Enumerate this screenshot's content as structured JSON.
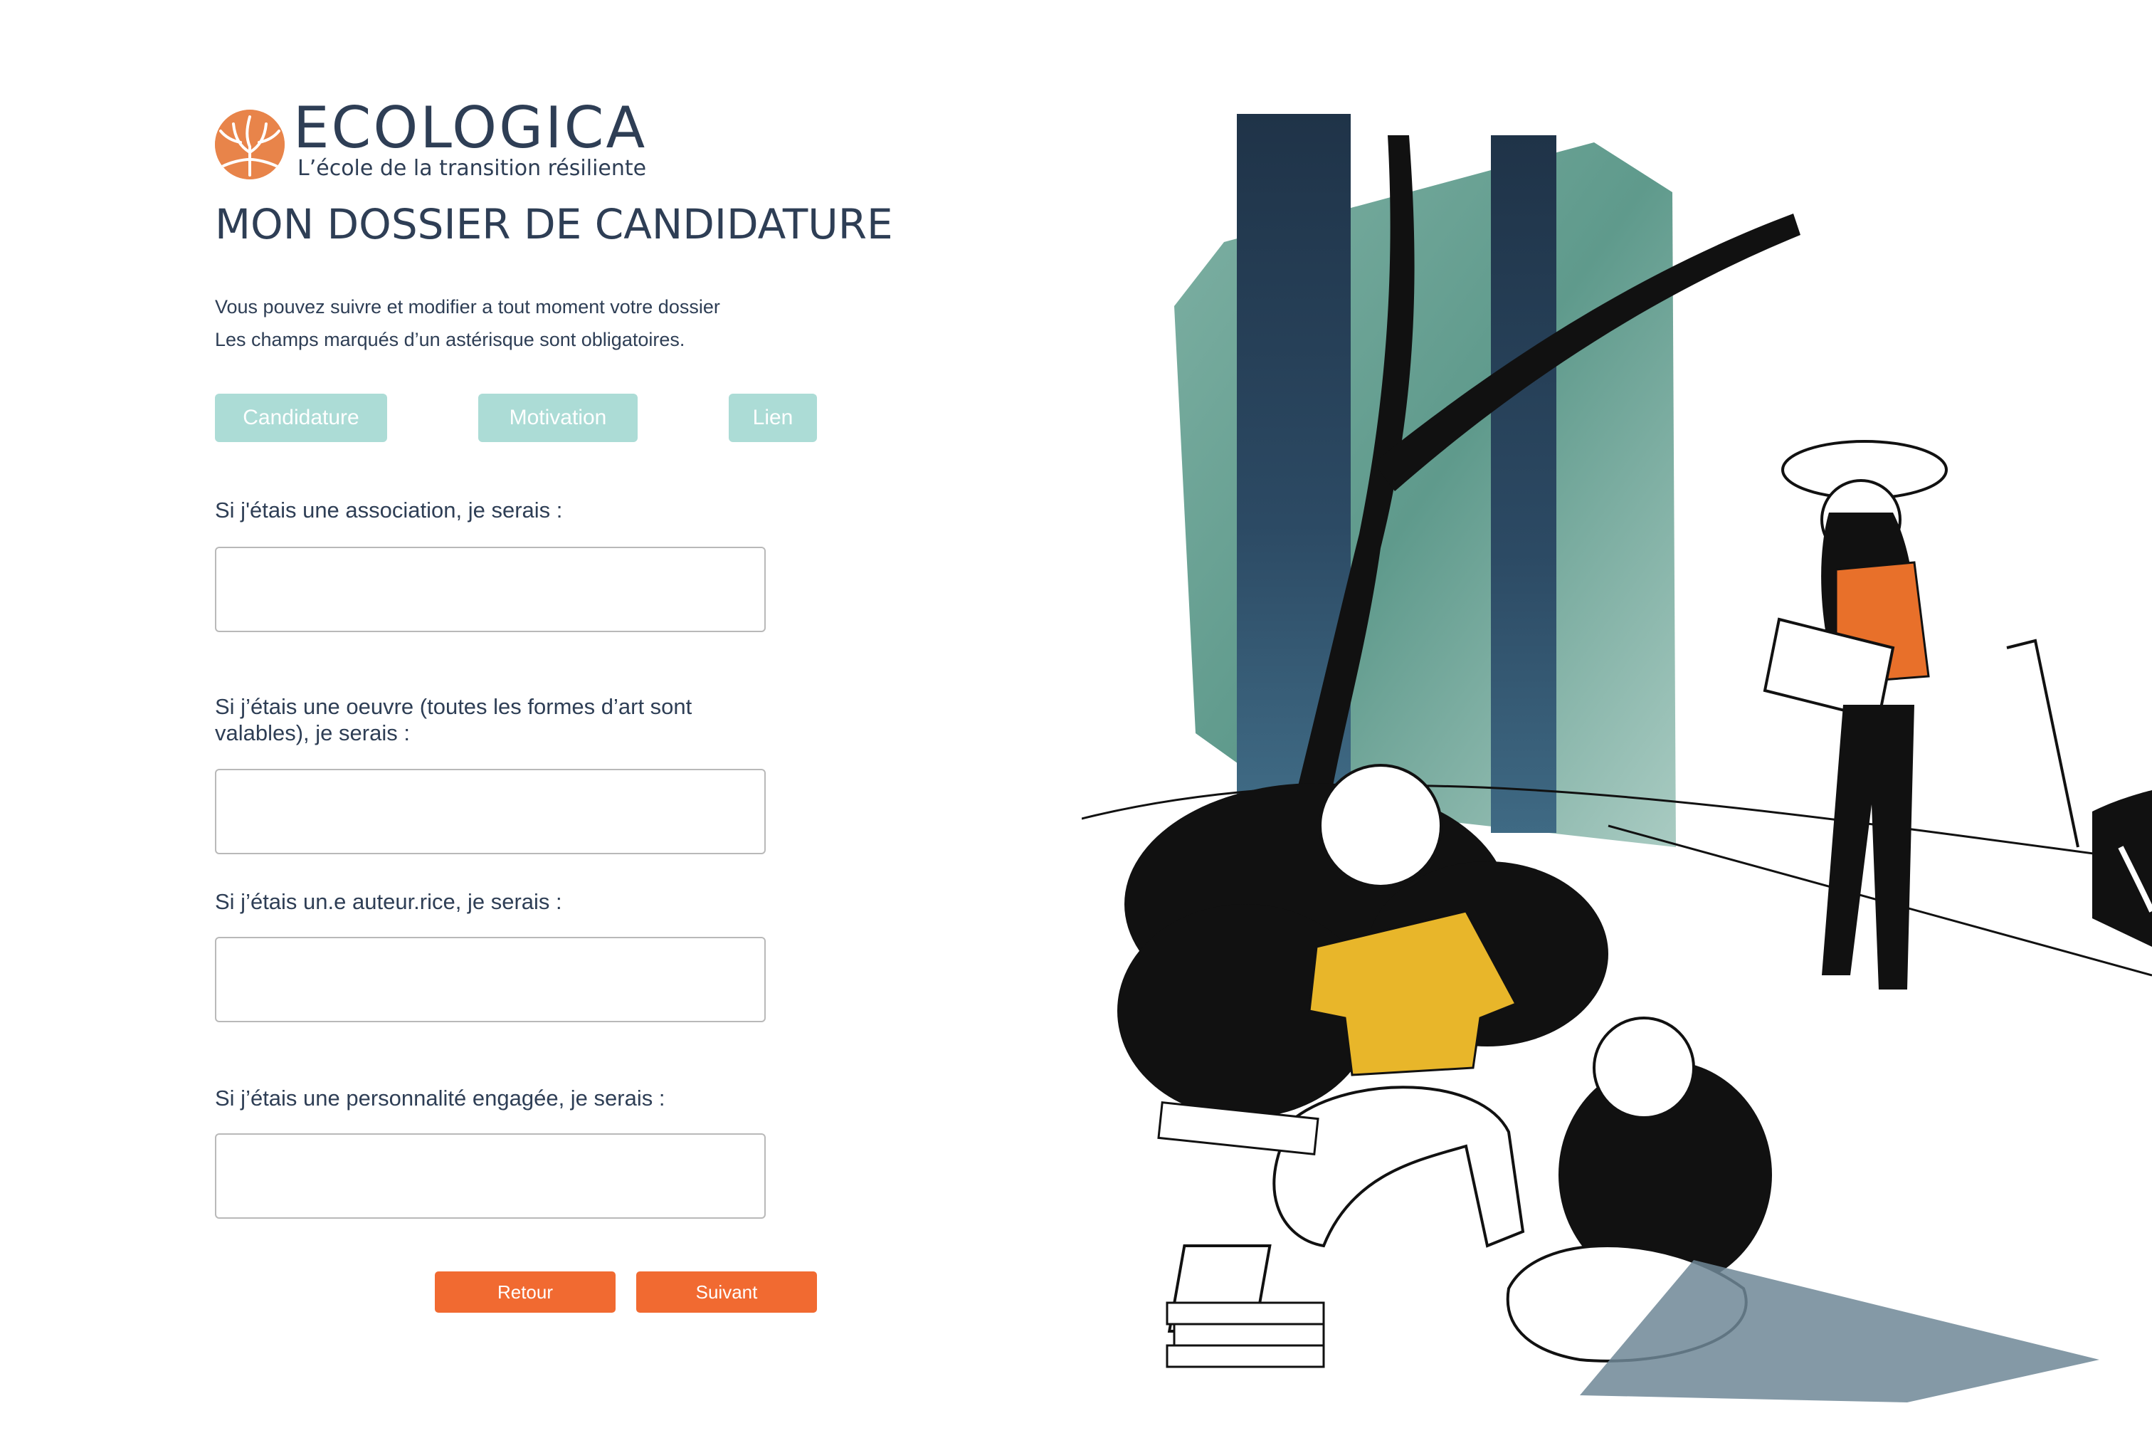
{
  "brand": {
    "name": "ECOLOGICA",
    "tagline": "L’école de la transition résiliente",
    "accent": "#e8844a",
    "text_color": "#2e3e55"
  },
  "page": {
    "title": "MON DOSSIER DE CANDIDATURE",
    "intro_line1": "Vous pouvez suivre et modifier a tout moment votre dossier",
    "intro_line2": "Les champs marqués d’un astérisque sont obligatoires."
  },
  "tabs": [
    {
      "label": "Candidature"
    },
    {
      "label": "Motivation"
    },
    {
      "label": "Lien"
    }
  ],
  "tab_color": "#acdcd6",
  "form": {
    "fields": [
      {
        "label": "Si j'étais une association, je serais :",
        "value": "",
        "placeholder": ""
      },
      {
        "label": "Si j’étais une oeuvre (toutes les formes d’art sont valables), je serais :",
        "value": "",
        "placeholder": ""
      },
      {
        "label": "Si j’étais un.e auteur.rice, je serais :",
        "value": "",
        "placeholder": ""
      },
      {
        "label": "Si j’étais une personnalité engagée, je serais :",
        "value": "",
        "placeholder": ""
      }
    ]
  },
  "actions": {
    "back_label": "Retour",
    "next_label": "Suivant",
    "button_color": "#f16a31"
  },
  "illustration": {
    "icon": "students-under-tree-illustration",
    "colors": [
      "#5f9a8c",
      "#2c4a64",
      "#e8b62a",
      "#e8702a",
      "#111111"
    ]
  }
}
